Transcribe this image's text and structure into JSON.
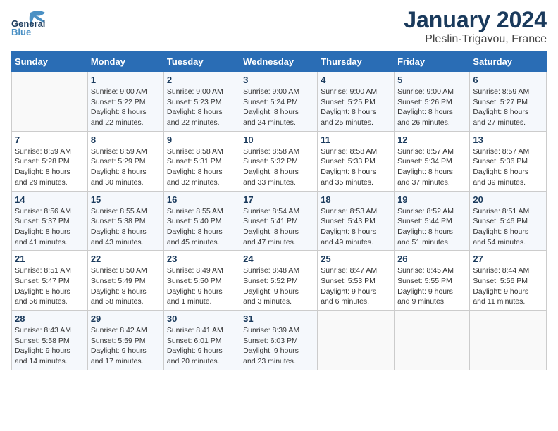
{
  "header": {
    "logo_general": "General",
    "logo_blue": "Blue",
    "title": "January 2024",
    "subtitle": "Pleslin-Trigavou, France"
  },
  "columns": [
    "Sunday",
    "Monday",
    "Tuesday",
    "Wednesday",
    "Thursday",
    "Friday",
    "Saturday"
  ],
  "weeks": [
    [
      {
        "day": "",
        "info": ""
      },
      {
        "day": "1",
        "info": "Sunrise: 9:00 AM\nSunset: 5:22 PM\nDaylight: 8 hours\nand 22 minutes."
      },
      {
        "day": "2",
        "info": "Sunrise: 9:00 AM\nSunset: 5:23 PM\nDaylight: 8 hours\nand 22 minutes."
      },
      {
        "day": "3",
        "info": "Sunrise: 9:00 AM\nSunset: 5:24 PM\nDaylight: 8 hours\nand 24 minutes."
      },
      {
        "day": "4",
        "info": "Sunrise: 9:00 AM\nSunset: 5:25 PM\nDaylight: 8 hours\nand 25 minutes."
      },
      {
        "day": "5",
        "info": "Sunrise: 9:00 AM\nSunset: 5:26 PM\nDaylight: 8 hours\nand 26 minutes."
      },
      {
        "day": "6",
        "info": "Sunrise: 8:59 AM\nSunset: 5:27 PM\nDaylight: 8 hours\nand 27 minutes."
      }
    ],
    [
      {
        "day": "7",
        "info": "Sunrise: 8:59 AM\nSunset: 5:28 PM\nDaylight: 8 hours\nand 29 minutes."
      },
      {
        "day": "8",
        "info": "Sunrise: 8:59 AM\nSunset: 5:29 PM\nDaylight: 8 hours\nand 30 minutes."
      },
      {
        "day": "9",
        "info": "Sunrise: 8:58 AM\nSunset: 5:31 PM\nDaylight: 8 hours\nand 32 minutes."
      },
      {
        "day": "10",
        "info": "Sunrise: 8:58 AM\nSunset: 5:32 PM\nDaylight: 8 hours\nand 33 minutes."
      },
      {
        "day": "11",
        "info": "Sunrise: 8:58 AM\nSunset: 5:33 PM\nDaylight: 8 hours\nand 35 minutes."
      },
      {
        "day": "12",
        "info": "Sunrise: 8:57 AM\nSunset: 5:34 PM\nDaylight: 8 hours\nand 37 minutes."
      },
      {
        "day": "13",
        "info": "Sunrise: 8:57 AM\nSunset: 5:36 PM\nDaylight: 8 hours\nand 39 minutes."
      }
    ],
    [
      {
        "day": "14",
        "info": "Sunrise: 8:56 AM\nSunset: 5:37 PM\nDaylight: 8 hours\nand 41 minutes."
      },
      {
        "day": "15",
        "info": "Sunrise: 8:55 AM\nSunset: 5:38 PM\nDaylight: 8 hours\nand 43 minutes."
      },
      {
        "day": "16",
        "info": "Sunrise: 8:55 AM\nSunset: 5:40 PM\nDaylight: 8 hours\nand 45 minutes."
      },
      {
        "day": "17",
        "info": "Sunrise: 8:54 AM\nSunset: 5:41 PM\nDaylight: 8 hours\nand 47 minutes."
      },
      {
        "day": "18",
        "info": "Sunrise: 8:53 AM\nSunset: 5:43 PM\nDaylight: 8 hours\nand 49 minutes."
      },
      {
        "day": "19",
        "info": "Sunrise: 8:52 AM\nSunset: 5:44 PM\nDaylight: 8 hours\nand 51 minutes."
      },
      {
        "day": "20",
        "info": "Sunrise: 8:51 AM\nSunset: 5:46 PM\nDaylight: 8 hours\nand 54 minutes."
      }
    ],
    [
      {
        "day": "21",
        "info": "Sunrise: 8:51 AM\nSunset: 5:47 PM\nDaylight: 8 hours\nand 56 minutes."
      },
      {
        "day": "22",
        "info": "Sunrise: 8:50 AM\nSunset: 5:49 PM\nDaylight: 8 hours\nand 58 minutes."
      },
      {
        "day": "23",
        "info": "Sunrise: 8:49 AM\nSunset: 5:50 PM\nDaylight: 9 hours\nand 1 minute."
      },
      {
        "day": "24",
        "info": "Sunrise: 8:48 AM\nSunset: 5:52 PM\nDaylight: 9 hours\nand 3 minutes."
      },
      {
        "day": "25",
        "info": "Sunrise: 8:47 AM\nSunset: 5:53 PM\nDaylight: 9 hours\nand 6 minutes."
      },
      {
        "day": "26",
        "info": "Sunrise: 8:45 AM\nSunset: 5:55 PM\nDaylight: 9 hours\nand 9 minutes."
      },
      {
        "day": "27",
        "info": "Sunrise: 8:44 AM\nSunset: 5:56 PM\nDaylight: 9 hours\nand 11 minutes."
      }
    ],
    [
      {
        "day": "28",
        "info": "Sunrise: 8:43 AM\nSunset: 5:58 PM\nDaylight: 9 hours\nand 14 minutes."
      },
      {
        "day": "29",
        "info": "Sunrise: 8:42 AM\nSunset: 5:59 PM\nDaylight: 9 hours\nand 17 minutes."
      },
      {
        "day": "30",
        "info": "Sunrise: 8:41 AM\nSunset: 6:01 PM\nDaylight: 9 hours\nand 20 minutes."
      },
      {
        "day": "31",
        "info": "Sunrise: 8:39 AM\nSunset: 6:03 PM\nDaylight: 9 hours\nand 23 minutes."
      },
      {
        "day": "",
        "info": ""
      },
      {
        "day": "",
        "info": ""
      },
      {
        "day": "",
        "info": ""
      }
    ]
  ]
}
